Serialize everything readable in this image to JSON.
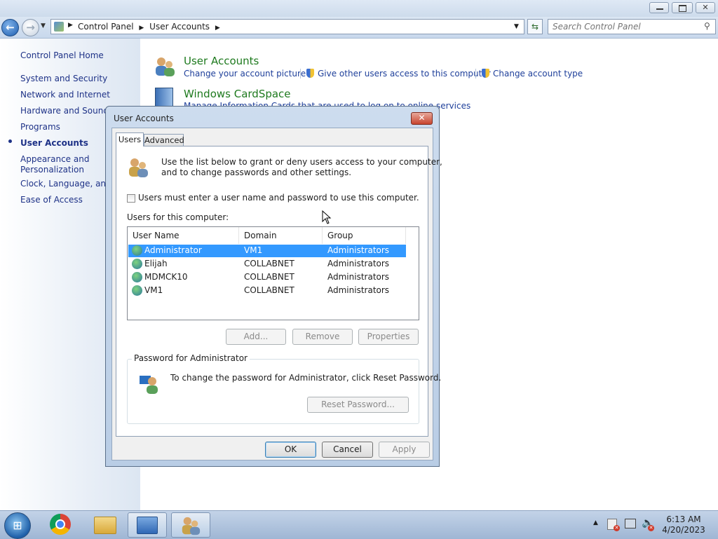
{
  "address_bar": {
    "breadcrumb": [
      "Control Panel",
      "User Accounts"
    ],
    "search_placeholder": "Search Control Panel"
  },
  "left_pane": {
    "home": "Control Panel Home",
    "items": [
      {
        "label": "System and Security"
      },
      {
        "label": "Network and Internet"
      },
      {
        "label": "Hardware and Sound"
      },
      {
        "label": "Programs"
      },
      {
        "label": "User Accounts",
        "selected": true
      },
      {
        "label": "Appearance and\nPersonalization"
      },
      {
        "label": "Clock, Language, and R"
      },
      {
        "label": "Ease of Access"
      }
    ]
  },
  "main": {
    "user_accounts": {
      "title": "User Accounts",
      "links": [
        "Change your account picture",
        "Give other users access to this computer",
        "Change account type"
      ]
    },
    "cardspace": {
      "title": "Windows CardSpace",
      "subtitle": "Manage Information Cards that are used to log on to online services"
    }
  },
  "dialog": {
    "title": "User Accounts",
    "close_label": "✕",
    "tabs": [
      "Users",
      "Advanced"
    ],
    "intro": "Use the list below to grant or deny users access to your computer,\nand to change passwords and other settings.",
    "checkbox_label": "Users must enter a user name and password to use this computer.",
    "checkbox_checked": false,
    "users_label": "Users for this computer:",
    "columns": [
      "User Name",
      "Domain",
      "Group"
    ],
    "users": [
      {
        "name": "Administrator",
        "domain": "VM1",
        "group": "Administrators",
        "selected": true
      },
      {
        "name": "Elijah",
        "domain": "COLLABNET",
        "group": "Administrators"
      },
      {
        "name": "MDMCK10",
        "domain": "COLLABNET",
        "group": "Administrators"
      },
      {
        "name": "VM1",
        "domain": "COLLABNET",
        "group": "Administrators"
      }
    ],
    "buttons": {
      "add": "Add...",
      "remove": "Remove",
      "properties": "Properties"
    },
    "password_group": {
      "label": "Password for Administrator",
      "text": "To change the password for Administrator, click Reset Password.",
      "reset": "Reset Password..."
    },
    "footer": {
      "ok": "OK",
      "cancel": "Cancel",
      "apply": "Apply"
    }
  },
  "taskbar": {
    "time": "6:13 AM",
    "date": "4/20/2023"
  },
  "colors": {
    "link": "#1e3f9a",
    "category_title": "#1e7a1e",
    "selection": "#3399ff"
  }
}
